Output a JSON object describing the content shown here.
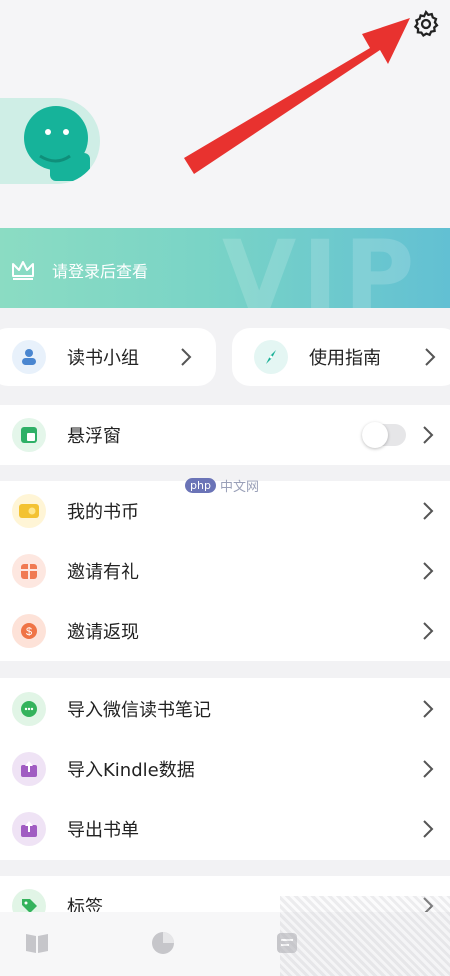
{
  "header": {
    "settings_icon": "gear-icon",
    "avatar_icon": "avatar-face-icon"
  },
  "vip_banner": {
    "text": "请登录后查看",
    "watermark": "VIP"
  },
  "quick_cards": [
    {
      "label": "读书小组",
      "icon": "group-icon"
    },
    {
      "label": "使用指南",
      "icon": "compass-icon"
    }
  ],
  "floating_window": {
    "label": "悬浮窗",
    "icon": "window-icon",
    "enabled": false
  },
  "wallet_section": [
    {
      "label": "我的书币",
      "icon": "coin-icon"
    },
    {
      "label": "邀请有礼",
      "icon": "gift-icon"
    },
    {
      "label": "邀请返现",
      "icon": "cash-icon"
    }
  ],
  "import_section": [
    {
      "label": "导入微信读书笔记",
      "icon": "wechat-icon"
    },
    {
      "label": "导入Kindle数据",
      "icon": "upload-icon"
    },
    {
      "label": "导出书单",
      "icon": "upload-icon"
    }
  ],
  "tags_row": {
    "label": "标签",
    "icon": "tag-icon"
  },
  "watermark": {
    "php": "php",
    "site": "中文网"
  },
  "tabbar": [
    "book-icon",
    "pie-chart-icon",
    "notes-icon"
  ]
}
